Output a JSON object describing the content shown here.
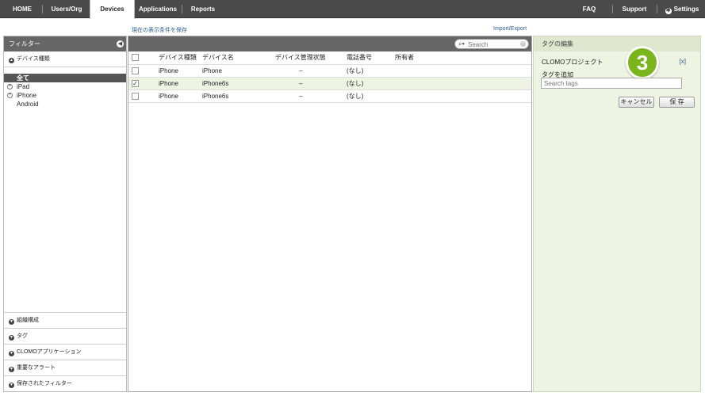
{
  "nav": {
    "tabs": [
      "HOME",
      "Users/Org",
      "Devices",
      "Applications",
      "Reports"
    ],
    "active_tab": "Devices",
    "faq": "FAQ",
    "support": "Support",
    "settings": "Settings"
  },
  "links": {
    "save_view": "現在の表示条件を保存",
    "import_export": "Import/Export"
  },
  "filter": {
    "title": "フィルター",
    "device_type_header": "デバイス種類",
    "items": [
      "全て",
      "iPad",
      "iPhone",
      "Android"
    ],
    "bottom_sections": [
      "組織構成",
      "タグ",
      "CLOMOアプリケーション",
      "重要なアラート",
      "保存されたフィルター"
    ]
  },
  "search": {
    "placeholder": "Search"
  },
  "table": {
    "columns": [
      "デバイス種類",
      "デバイス名",
      "デバイス管理状態",
      "電話番号",
      "所有者"
    ],
    "rows": [
      {
        "checked": false,
        "type": "iPhone",
        "name": "iPhone",
        "status": "–",
        "phone": "(なし)",
        "owner": ""
      },
      {
        "checked": true,
        "type": "iPhone",
        "name": "iPhone6s",
        "status": "–",
        "phone": "(なし)",
        "owner": ""
      },
      {
        "checked": false,
        "type": "iPhone",
        "name": "iPhone6s",
        "status": "–",
        "phone": "(なし)",
        "owner": ""
      }
    ]
  },
  "tag_panel": {
    "title": "タグの編集",
    "project": "CLOMOプロジェクト",
    "close": "[x]",
    "badge": "3",
    "add_label": "タグを追加",
    "input_placeholder": "Search tags",
    "cancel": "キャンセル",
    "save": "保 存"
  },
  "colors": {
    "nav_bg": "#4a4a4a",
    "accent_green": "#7ab51d",
    "link": "#2b5d99",
    "panel_green": "#eef4e2"
  }
}
